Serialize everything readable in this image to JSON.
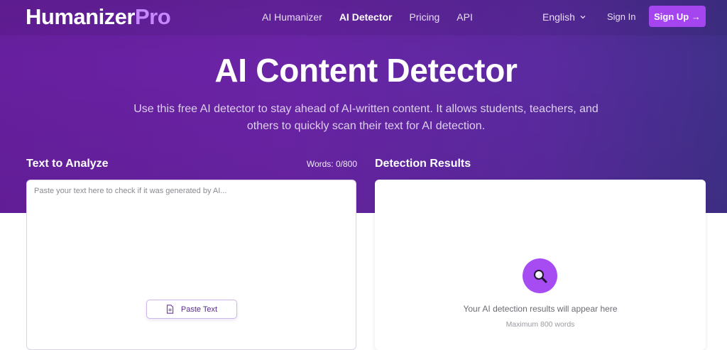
{
  "brand": {
    "name_main": "Humanizer",
    "name_accent": "Pro"
  },
  "nav": {
    "links": [
      {
        "label": "AI Humanizer"
      },
      {
        "label": "AI Detector"
      },
      {
        "label": "Pricing"
      },
      {
        "label": "API"
      }
    ],
    "language": "English",
    "signin": "Sign In",
    "signup": "Sign Up →"
  },
  "hero": {
    "title": "AI Content Detector",
    "subtitle": "Use this free AI detector to stay ahead of AI-written content. It allows students, teachers, and others to quickly scan their text for AI detection."
  },
  "analyze": {
    "heading": "Text to Analyze",
    "word_count": "Words: 0/800",
    "placeholder": "Paste your text here to check if it was generated by AI...",
    "paste_label": "Paste Text"
  },
  "results": {
    "heading": "Detection Results",
    "empty_message": "Your AI detection results will appear here",
    "limit_note": "Maximum 800 words"
  },
  "icons": {
    "chevron": "chevron-down-icon",
    "clipboard": "document-icon",
    "search": "magnifier-icon"
  },
  "colors": {
    "accent": "#a445f0",
    "hero_start": "#671f9f",
    "hero_end": "#40308a",
    "brand_accent": "#c688ff"
  }
}
